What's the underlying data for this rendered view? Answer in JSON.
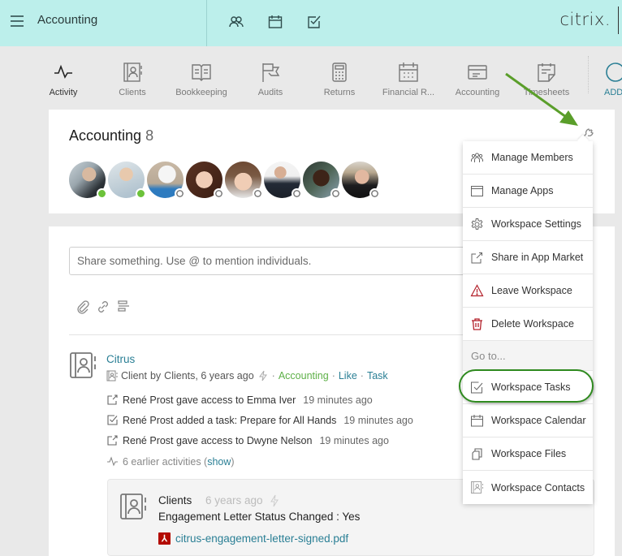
{
  "topbar": {
    "title": "Accounting",
    "brand": "citrix.",
    "icons": [
      "members-icon",
      "calendar-icon",
      "tasks-icon"
    ],
    "bg_color": "#bcefeb"
  },
  "apps": [
    {
      "label": "Activity",
      "icon": "activity-icon",
      "active": true
    },
    {
      "label": "Clients",
      "icon": "contacts-book-icon"
    },
    {
      "label": "Bookkeeping",
      "icon": "open-book-icon"
    },
    {
      "label": "Audits",
      "icon": "flag-icon"
    },
    {
      "label": "Returns",
      "icon": "calculator-icon"
    },
    {
      "label": "Financial R...",
      "icon": "calendar-grid-icon"
    },
    {
      "label": "Accounting",
      "icon": "card-icon"
    },
    {
      "label": "Timesheets",
      "icon": "note-icon"
    }
  ],
  "add_app": {
    "label": "ADD"
  },
  "workspace": {
    "name": "Accounting",
    "member_count": "8",
    "members": [
      {
        "status": "online"
      },
      {
        "status": "online"
      },
      {
        "status": "offline"
      },
      {
        "status": "offline"
      },
      {
        "status": "offline"
      },
      {
        "status": "offline"
      },
      {
        "status": "offline"
      },
      {
        "status": "offline"
      }
    ]
  },
  "feed": {
    "share_placeholder": "Share something. Use @ to mention individuals.",
    "post": {
      "title": "Citrus",
      "type": "Client",
      "by": "by",
      "source": "Clients, 6 years ago",
      "sep": "·",
      "workspace_link": "Accounting",
      "like": "Like",
      "task": "Task",
      "activities": [
        {
          "icon": "share-icon",
          "text": "René Prost gave access to Emma Iver",
          "time": "19 minutes ago"
        },
        {
          "icon": "task-check-icon",
          "text": "René Prost added a task: Prepare for All Hands",
          "time": "19 minutes ago"
        },
        {
          "icon": "share-icon",
          "text": "René Prost gave access to Dwyne Nelson",
          "time": "19 minutes ago"
        }
      ],
      "earlier_prefix": "6 earlier activities (",
      "earlier_show": "show",
      "earlier_suffix": ")"
    },
    "sub_post": {
      "source": "Clients",
      "time": "6 years ago",
      "text": "Engagement Letter Status Changed : Yes",
      "file": "citrus-engagement-letter-signed.pdf"
    }
  },
  "menu": {
    "items": [
      {
        "label": "Manage Members",
        "icon": "members-icon"
      },
      {
        "label": "Manage Apps",
        "icon": "window-icon"
      },
      {
        "label": "Workspace Settings",
        "icon": "gear-icon"
      },
      {
        "label": "Share in App Market",
        "icon": "share-icon"
      },
      {
        "label": "Leave Workspace",
        "icon": "warning-icon"
      },
      {
        "label": "Delete Workspace",
        "icon": "trash-icon"
      }
    ],
    "goto_header": "Go to...",
    "goto_items": [
      {
        "label": "Workspace Tasks",
        "icon": "task-check-icon",
        "highlighted": true
      },
      {
        "label": "Workspace Calendar",
        "icon": "calendar-icon"
      },
      {
        "label": "Workspace Files",
        "icon": "files-icon"
      },
      {
        "label": "Workspace Contacts",
        "icon": "contacts-book-icon"
      }
    ]
  },
  "colors": {
    "link": "#2a7f95",
    "green_link": "#5db047",
    "danger": "#b3212b",
    "annotation": "#5a9e2a",
    "online": "#6cc23a"
  }
}
